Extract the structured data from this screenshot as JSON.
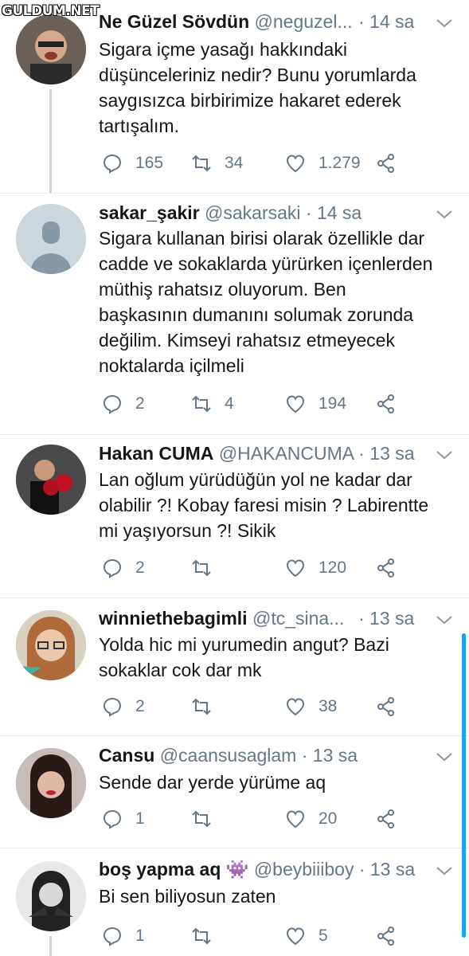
{
  "watermark": "GULDUM.NET",
  "tweets": [
    {
      "name": "Ne Güzel Sövdün",
      "handle": "@neguzel...",
      "time": "· 14 sa",
      "text": "Sigara içme yasağı hakkındaki\ndüşünceleriniz nedir? Bunu yorumlarda\nsaygısızca birbirimize hakaret ederek\ntartışalım.",
      "reply_count": "165",
      "retweet_count": "34",
      "like_count": "1.279",
      "avatar_color": "#5a5048"
    },
    {
      "name": "sakar_şakir",
      "handle": "@sakarsaki · 14 sa",
      "time": "",
      "text": "Sigara kullanan birisi olarak özellikle dar\ncadde ve sokaklarda yürürken içenlerden\nmüthiş rahatsız oluyorum. Ben\nbaşkasının dumanını solumak zorunda\ndeğilim. Kimseyi rahatsız etmeyecek\nnoktalarda içilmeli",
      "reply_count": "2",
      "retweet_count": "4",
      "like_count": "194",
      "avatar_color": "#ccd6dd"
    },
    {
      "name": "Hakan CUMA",
      "handle": "@HAKANCUMA · 13 sa",
      "time": "",
      "text": "Lan oğlum yürüdüğün yol ne kadar dar\nolabilir ?! Kobay faresi misin ? Labirentte\nmi yaşıyorsun ?! Sikik",
      "reply_count": "2",
      "retweet_count": "",
      "like_count": "120",
      "avatar_color": "#3a3a3a"
    },
    {
      "name": "winniethebagimli",
      "handle": "@tc_sina...",
      "time": "· 13 sa",
      "text": "Yolda hic mi yurumedin angut?  Bazi\nsokaklar cok dar mk",
      "reply_count": "2",
      "retweet_count": "",
      "like_count": "38",
      "avatar_color": "#b89a7a"
    },
    {
      "name": "Cansu",
      "handle": "@caansusaglam · 13 sa",
      "time": "",
      "text": "Sende dar yerde yürüme aq",
      "reply_count": "1",
      "retweet_count": "",
      "like_count": "20",
      "avatar_color": "#7a6a66"
    },
    {
      "name": "boş yapma aq 👾",
      "handle": "@beybiiiboy · 13 sa",
      "time": "",
      "text": "Bi sen biliyosun zaten",
      "reply_count": "1",
      "retweet_count": "",
      "like_count": "5",
      "avatar_color": "#d8d8d8"
    }
  ],
  "colors": {
    "text": "#14171a",
    "muted": "#657786",
    "accent": "#1da1f2",
    "divider": "#e6ecf0"
  },
  "icons": [
    "reply-icon",
    "retweet-icon",
    "like-icon",
    "share-icon",
    "chevron-down-icon"
  ]
}
